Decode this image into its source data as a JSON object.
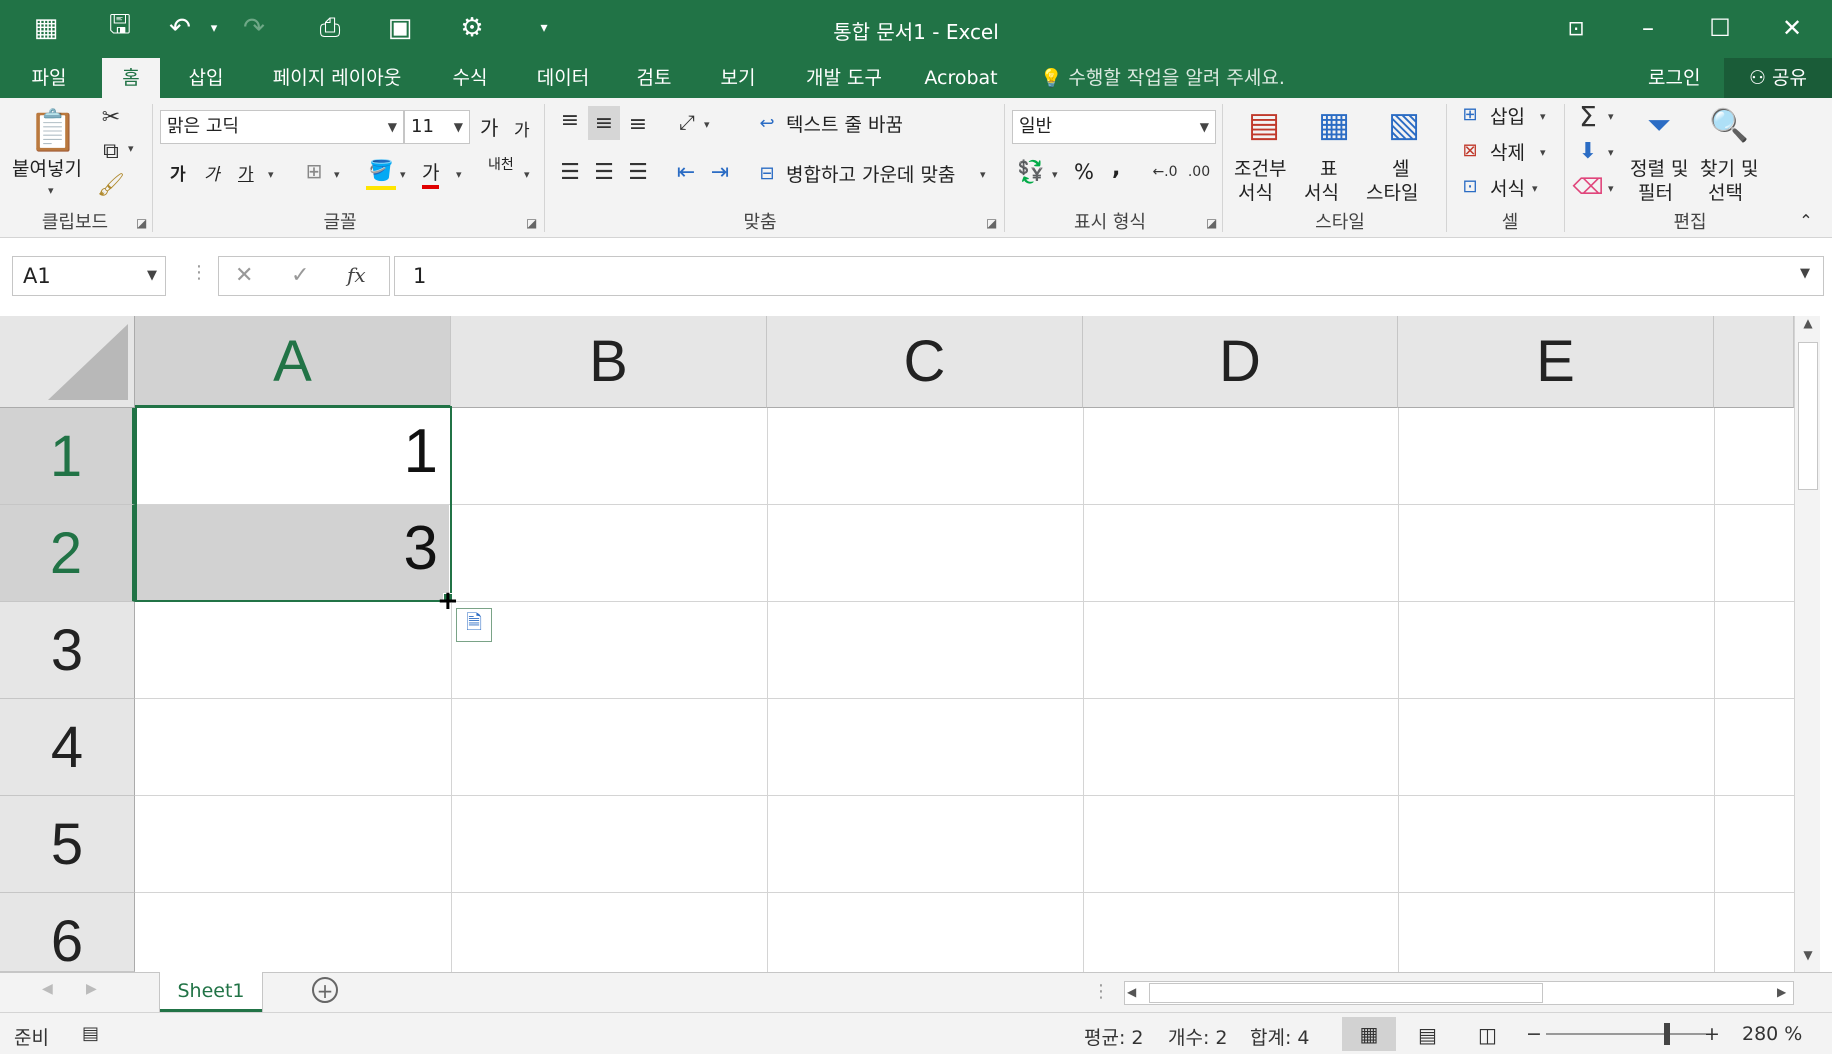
{
  "window": {
    "title": "통합 문서1 - Excel",
    "accent": "#217346"
  },
  "quick_access": [
    "grid-form-icon",
    "save-icon",
    "undo-icon",
    "redo-icon",
    "print-preview-icon",
    "camera-icon",
    "form-icon",
    "customize-qat-icon"
  ],
  "tabs": [
    {
      "label": "파일"
    },
    {
      "label": "홈"
    },
    {
      "label": "삽입"
    },
    {
      "label": "페이지 레이아웃"
    },
    {
      "label": "수식"
    },
    {
      "label": "데이터"
    },
    {
      "label": "검토"
    },
    {
      "label": "보기"
    },
    {
      "label": "개발 도구"
    },
    {
      "label": "Acrobat"
    }
  ],
  "tell_me": "수행할 작업을 알려 주세요.",
  "account": {
    "login": "로그인",
    "share": "공유"
  },
  "ribbon": {
    "clipboard": {
      "label": "클립보드",
      "paste": "붙여넣기"
    },
    "font": {
      "label": "글꼴",
      "name": "맑은 고딕",
      "size": "11",
      "grow": "가",
      "shrink": "가",
      "bold": "가",
      "italic": "가",
      "underline": "가",
      "color_letter": "가",
      "phonetic": "내천"
    },
    "alignment": {
      "label": "맞춤",
      "wrap": "텍스트 줄 바꿈",
      "merge": "병합하고 가운데 맞춤"
    },
    "number": {
      "label": "표시 형식",
      "format": "일반",
      "percent": "%",
      "comma": ","
    },
    "styles": {
      "label": "스타일",
      "cond_line1": "조건부",
      "cond_line2": "서식",
      "table_line1": "표",
      "table_line2": "서식",
      "cell_line1": "셀",
      "cell_line2": "스타일"
    },
    "cells": {
      "label": "셀",
      "insert": "삽입",
      "delete": "삭제",
      "format": "서식"
    },
    "editing": {
      "label": "편집",
      "sort_line1": "정렬 및",
      "sort_line2": "필터",
      "find_line1": "찾기 및",
      "find_line2": "선택"
    }
  },
  "formula_bar": {
    "name_box": "A1",
    "formula": "1",
    "fx": "fx"
  },
  "grid": {
    "columns": [
      "A",
      "B",
      "C",
      "D",
      "E"
    ],
    "rows": [
      "1",
      "2",
      "3",
      "4",
      "5",
      "6"
    ],
    "cells": {
      "A1": "1",
      "A2": "3"
    }
  },
  "sheets": [
    {
      "name": "Sheet1"
    }
  ],
  "status": {
    "ready": "준비",
    "average": "평균: 2",
    "count": "개수: 2",
    "sum": "합계: 4",
    "zoom": "280 %"
  }
}
